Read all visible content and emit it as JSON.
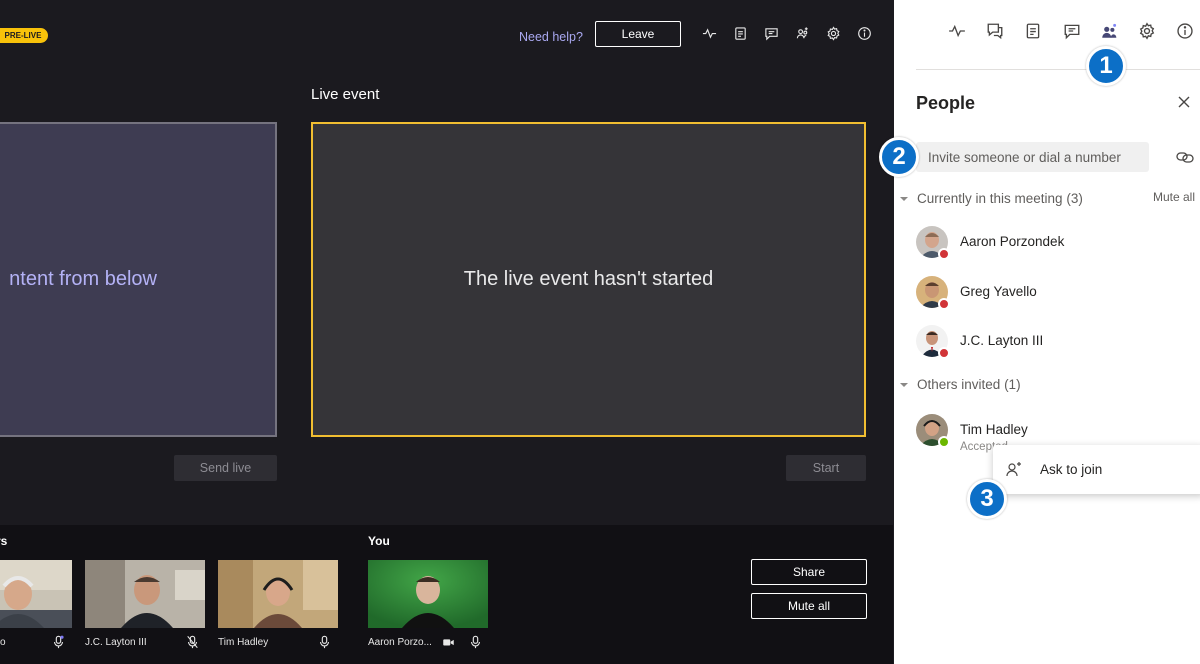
{
  "stage": {
    "prelive_badge": "PRE-LIVE",
    "need_help": "Need help?",
    "leave_label": "Leave",
    "live_event_label": "Live event",
    "queue_preview_text": "ntent from below",
    "send_live_label": "Send live",
    "live_preview_text": "The live event hasn't started",
    "start_label": "Start",
    "top_icons": [
      "health-icon",
      "qna-icon",
      "notes-icon",
      "chat-icon",
      "people-icon",
      "settings-icon",
      "info-icon"
    ]
  },
  "tray": {
    "presenters_label": "rs",
    "you_label": "You",
    "tiles": [
      {
        "name": "o",
        "icon": "mic-icon"
      },
      {
        "name": "J.C. Layton III",
        "icon": "mic-off-icon"
      },
      {
        "name": "Tim Hadley",
        "icon": "mic-icon"
      },
      {
        "name": "Aaron Porzo...",
        "icons": [
          "video-icon",
          "mic-icon"
        ]
      }
    ],
    "share_label": "Share",
    "mute_all_label": "Mute all"
  },
  "panel": {
    "icons": [
      "health-icon",
      "qna-icon",
      "notes-icon",
      "chat-icon",
      "people-icon",
      "settings-icon",
      "info-icon"
    ],
    "title": "People",
    "invite_placeholder": "Invite someone or dial a number",
    "current_section": "Currently in this meeting",
    "current_count": "(3)",
    "mute_all": "Mute all",
    "current_people": [
      {
        "name": "Aaron Porzondek",
        "presence": "#d13438"
      },
      {
        "name": "Greg Yavello",
        "presence": "#d13438"
      },
      {
        "name": "J.C. Layton III",
        "presence": "#d13438"
      }
    ],
    "others_section": "Others invited",
    "others_count": "(1)",
    "others_people": [
      {
        "name": "Tim Hadley",
        "status": "Accepted",
        "presence": "#6bb700"
      }
    ],
    "ask_to_join": "Ask to join"
  },
  "callouts": [
    "1",
    "2",
    "3"
  ],
  "colors": {
    "accent_yellow": "#f1be31",
    "callout_blue": "#0c6fc7",
    "link_purple": "#a9a8f0"
  }
}
